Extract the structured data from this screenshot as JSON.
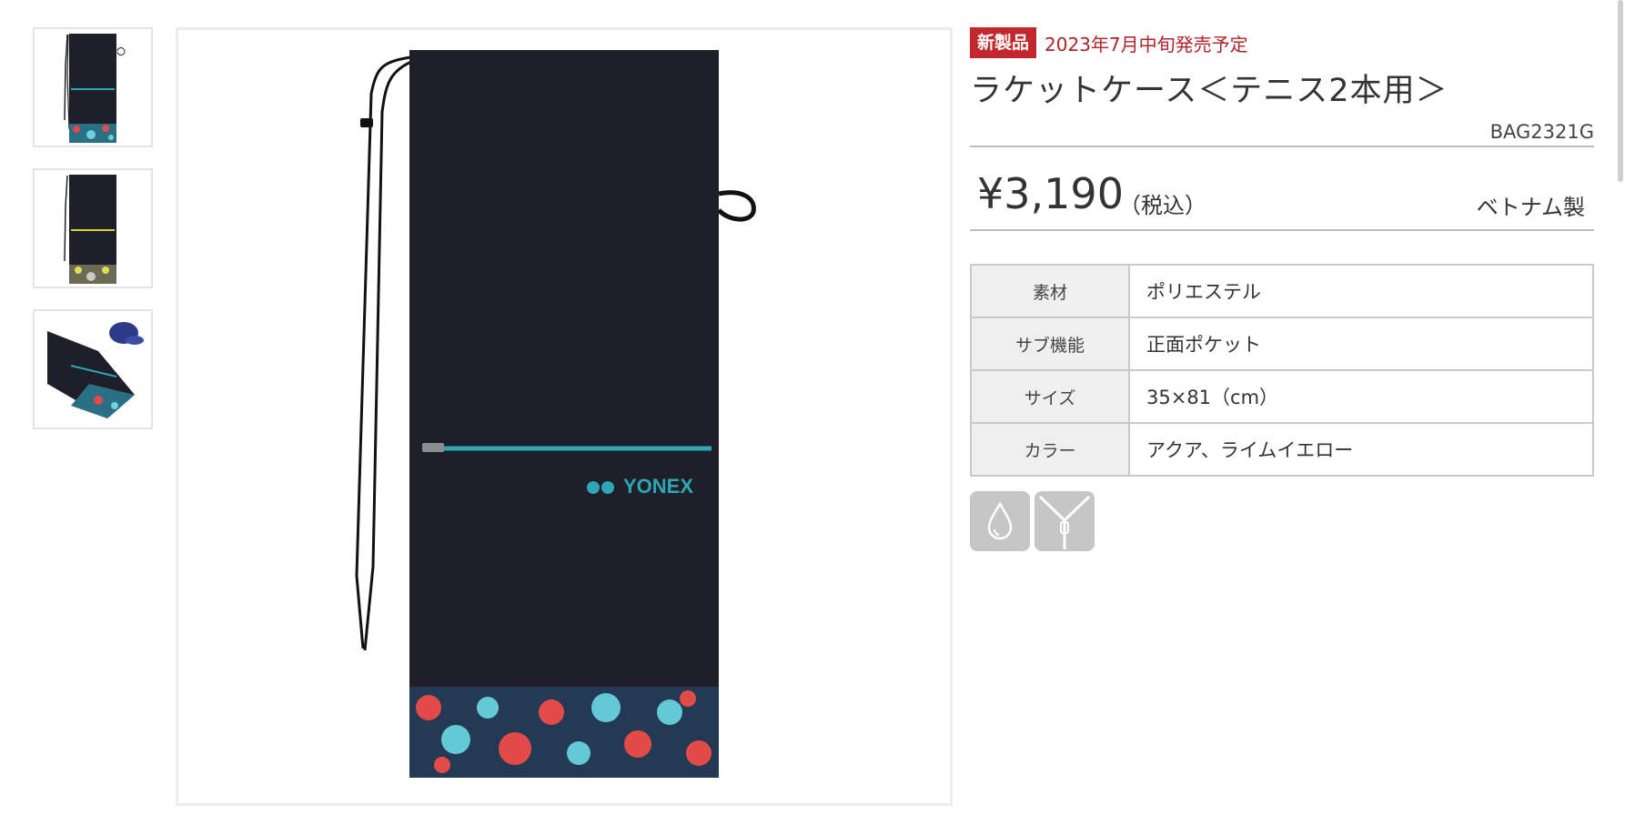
{
  "thumbnails": [
    {
      "alt": "aqua-front"
    },
    {
      "alt": "lime-yellow-front"
    },
    {
      "alt": "aqua-with-cap"
    }
  ],
  "main_image": {
    "brand_logo": "YONEX"
  },
  "badge": "新製品",
  "release": "2023年7月中旬発売予定",
  "title": "ラケットケース＜テニス2本用＞",
  "code": "BAG2321G",
  "price": "¥3,190",
  "tax_note": "（税込）",
  "origin": "ベトナム製",
  "specs": [
    {
      "key": "素材",
      "value": "ポリエステル"
    },
    {
      "key": "サブ機能",
      "value": "正面ポケット"
    },
    {
      "key": "サイズ",
      "value": "35×81（cm）"
    },
    {
      "key": "カラー",
      "value": "アクア、ライムイエロー"
    }
  ],
  "feature_icons": [
    "water-drop-icon",
    "zipper-icon"
  ],
  "colors": {
    "accent_red": "#c2272d",
    "bag_black": "#1e1f28",
    "aqua": "#2ea6b6",
    "lime": "#d9d32e"
  }
}
